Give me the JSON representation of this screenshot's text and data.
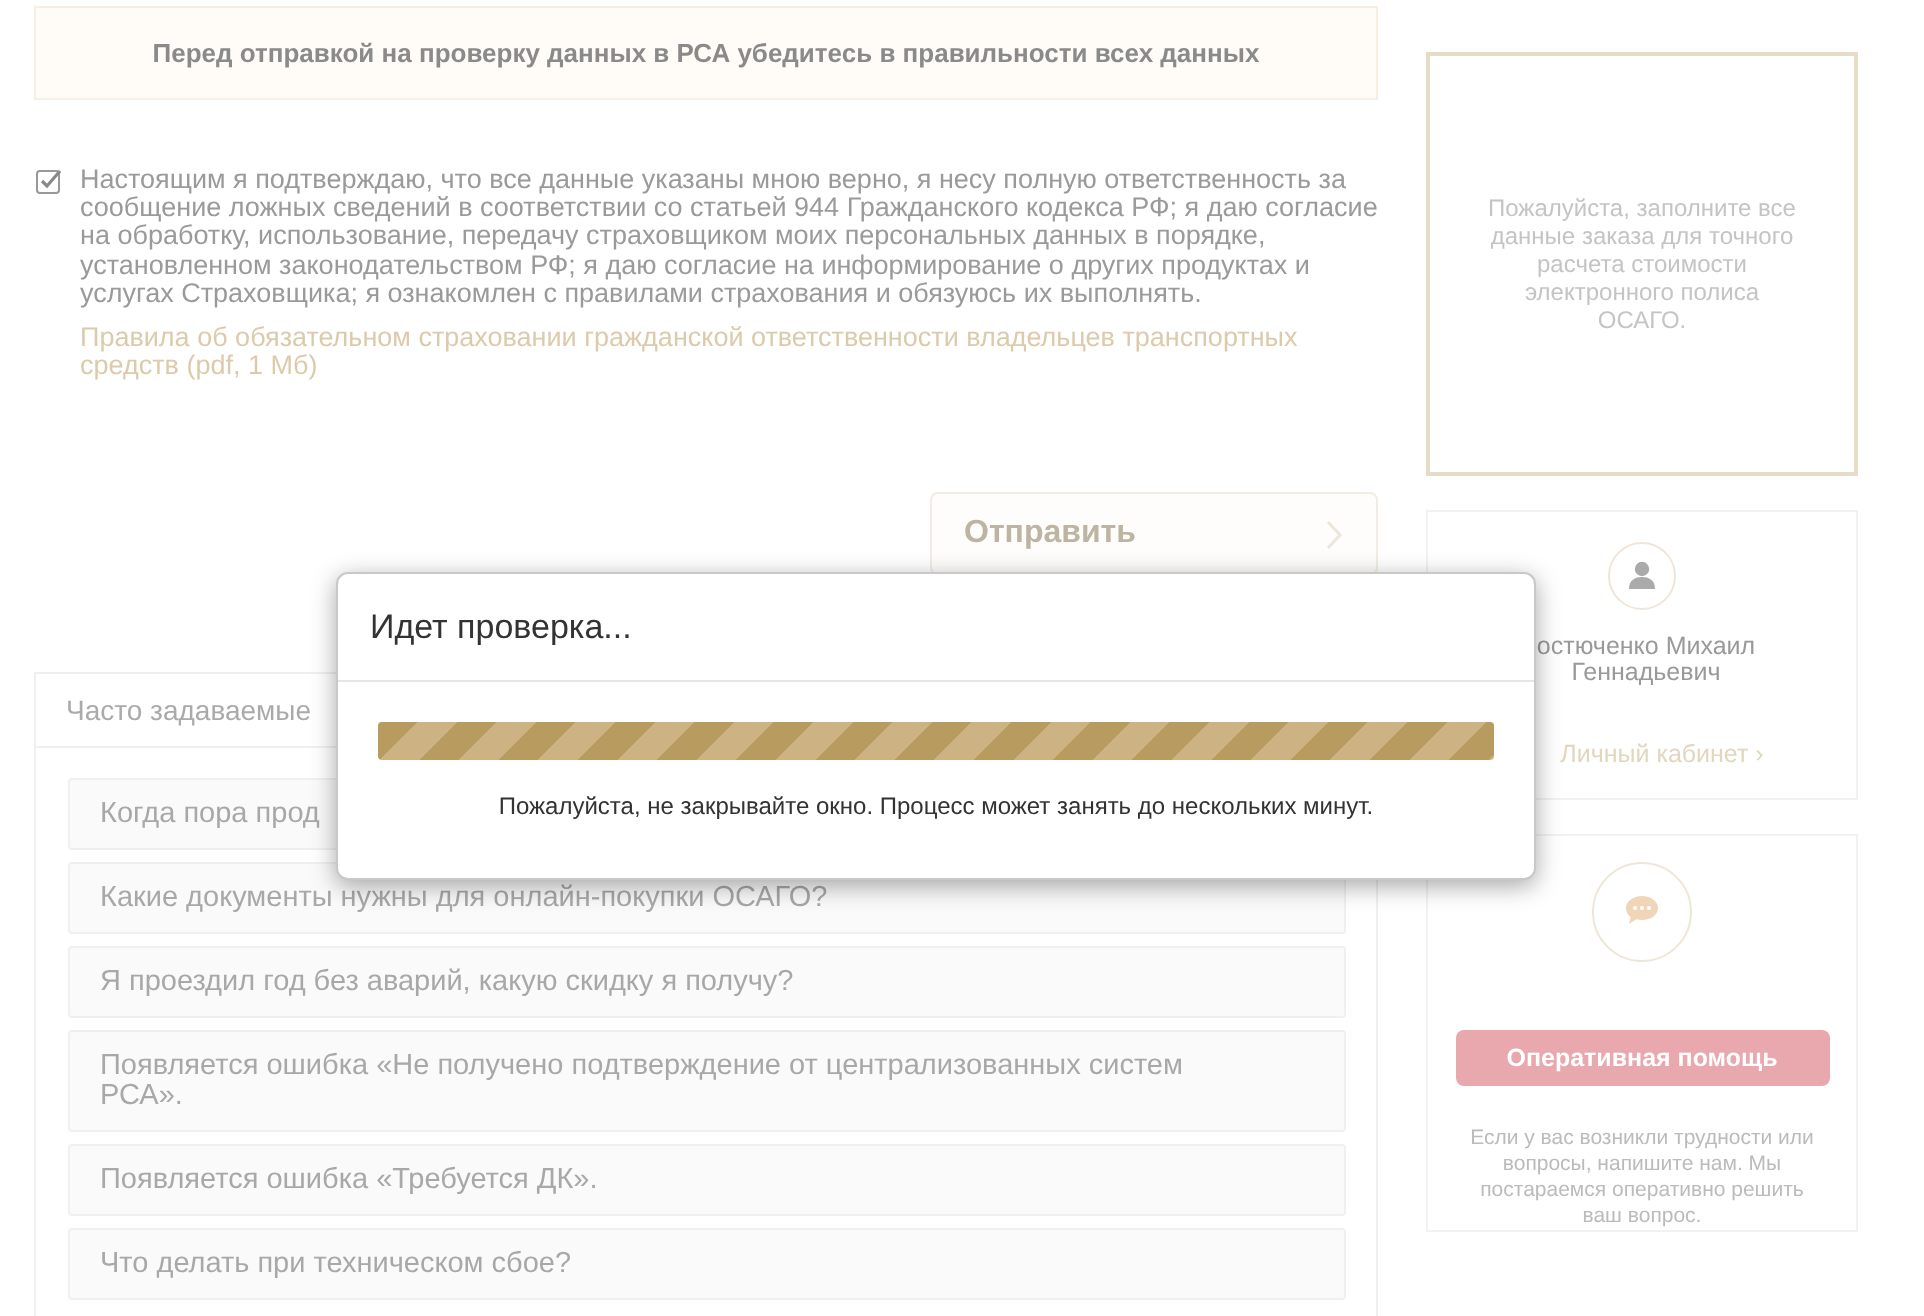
{
  "notice": {
    "text": "Перед отправкой на проверку данных в РСА убедитесь в правильности всех данных"
  },
  "consent": {
    "checked": true,
    "text": "Настоящим я подтверждаю, что все данные указаны мною верно, я несу полную ответственность за сообщение ложных сведений в соответствии со статьей 944 Гражданского кодекса РФ; я даю согласие на обработку, использование, передачу страховщиком моих персональных данных в порядке, установленном законодательством РФ; я даю согласие на информирование о других продуктах и услугах Страховщика; я ознакомлен с правилами страхования и обязуюсь их выполнять.",
    "link": "Правила об обязательном страховании гражданской ответственности владельцев транспортных средств (pdf, 1 Мб)"
  },
  "submit_button": {
    "label": "Отправить",
    "disabled": true
  },
  "faq": {
    "title": "Часто задаваемые",
    "items": [
      {
        "text": "Когда пора прод"
      },
      {
        "text": "Какие документы нужны для онлайн-покупки ОСАГО?"
      },
      {
        "text": "Я проездил год без аварий, какую скидку я получу?"
      },
      {
        "text": "Появляется ошибка «Не получено подтверждение от централизованных систем РСА»."
      },
      {
        "text": "Появляется ошибка «Требуется ДК»."
      },
      {
        "text": "Что делать при техническом сбое?"
      }
    ]
  },
  "summary": {
    "text": "Пожалуйста, заполните все данные заказа для точного расчета стоимости электронного полиса ОСАГО."
  },
  "profile": {
    "name": "остюченко Михаил Геннадьевич",
    "link": "Личный кабинет ›"
  },
  "help": {
    "button": "Оперативная помощь",
    "text": "Если у вас возникли трудности или вопросы, напишите нам. Мы постараемся оперативно решить ваш вопрос."
  },
  "dialog": {
    "title": "Идет проверка...",
    "level": 1,
    "message": "Пожалуйста, не закрывайте окно. Процесс может занять до нескольких минут."
  }
}
